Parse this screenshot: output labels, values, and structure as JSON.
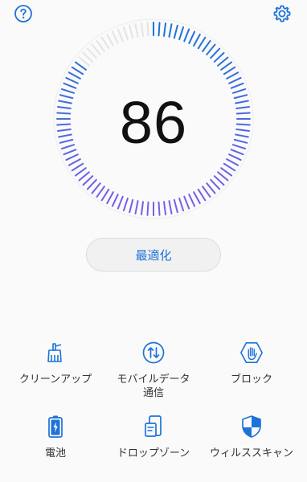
{
  "score": "86",
  "optimize_label": "最適化",
  "accent_color": "#1e73d8",
  "gauge": {
    "level": 0.86,
    "active_color_top": "#1e73d8",
    "active_color_bottom": "#7b5ee6",
    "inactive_color": "#e4e4e4"
  },
  "top_bar": {
    "help_icon": "question-mark-circle-icon",
    "settings_icon": "gear-icon"
  },
  "tools": [
    {
      "label": "クリーンアップ",
      "icon": "broom-icon"
    },
    {
      "label": "モバイルデータ\n通信",
      "icon": "data-transfer-icon"
    },
    {
      "label": "ブロック",
      "icon": "hand-block-icon"
    },
    {
      "label": "電池",
      "icon": "battery-icon"
    },
    {
      "label": "ドロップゾーン",
      "icon": "drop-zone-icon"
    },
    {
      "label": "ウィルススキャン",
      "icon": "shield-icon"
    }
  ]
}
